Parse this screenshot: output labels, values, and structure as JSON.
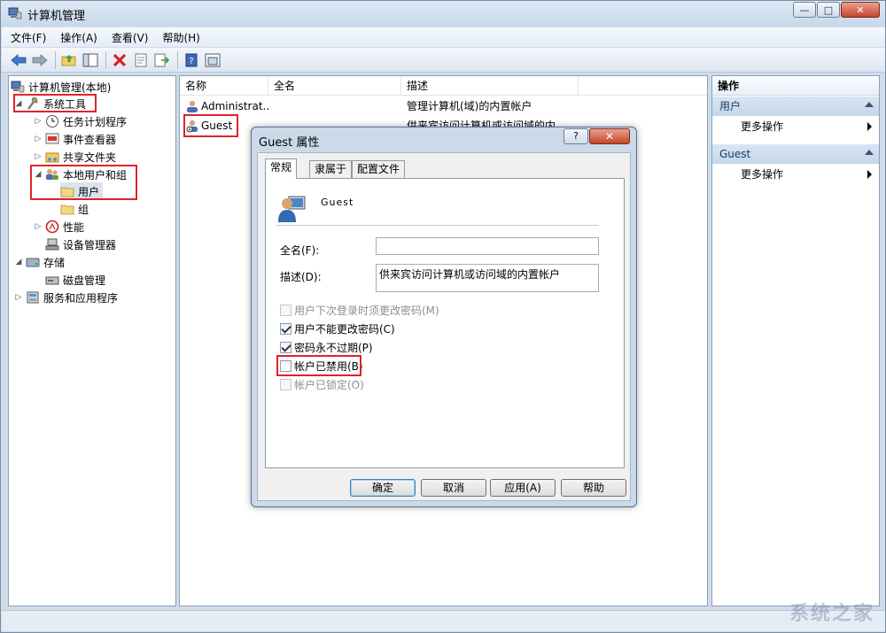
{
  "window": {
    "title": "计算机管理",
    "controls": {
      "minimize": "—",
      "maximize": "□",
      "close": "✕"
    }
  },
  "menu": [
    "文件(F)",
    "操作(A)",
    "查看(V)",
    "帮助(H)"
  ],
  "tree": {
    "root": "计算机管理(本地)",
    "system_tools": "系统工具",
    "task_scheduler": "任务计划程序",
    "event_viewer": "事件查看器",
    "shared_folders": "共享文件夹",
    "local_users_groups": "本地用户和组",
    "users": "用户",
    "groups": "组",
    "performance": "性能",
    "device_manager": "设备管理器",
    "storage": "存储",
    "disk_management": "磁盘管理",
    "services_apps": "服务和应用程序"
  },
  "list": {
    "columns": [
      "名称",
      "全名",
      "描述"
    ],
    "rows": [
      {
        "name": "Administrat...",
        "fullname": "",
        "desc": "管理计算机(域)的内置帐户"
      },
      {
        "name": "Guest",
        "fullname": "",
        "desc": "供来宾访问计算机或访问域的内..."
      }
    ]
  },
  "actions": {
    "title": "操作",
    "sections": [
      {
        "header": "用户",
        "item": "更多操作"
      },
      {
        "header": "Guest",
        "item": "更多操作"
      }
    ]
  },
  "dialog": {
    "title": "Guest 属性",
    "help": "?",
    "close": "✕",
    "tabs": [
      "常规",
      "隶属于",
      "配置文件"
    ],
    "username": "Guest",
    "fullname_label": "全名(F):",
    "fullname_value": "",
    "desc_label": "描述(D):",
    "desc_value": "供来宾访问计算机或访问域的内置帐户",
    "checkboxes": [
      {
        "label": "用户下次登录时须更改密码(M)",
        "checked": false,
        "disabled": true
      },
      {
        "label": "用户不能更改密码(C)",
        "checked": true,
        "disabled": false
      },
      {
        "label": "密码永不过期(P)",
        "checked": true,
        "disabled": false
      },
      {
        "label": "帐户已禁用(B)",
        "checked": false,
        "disabled": false
      },
      {
        "label": "帐户已锁定(O)",
        "checked": false,
        "disabled": true
      }
    ],
    "buttons": {
      "ok": "确定",
      "cancel": "取消",
      "apply": "应用(A)",
      "help": "帮助"
    }
  },
  "watermark": "系统之家",
  "colors": {
    "highlight": "#e0232a",
    "accent": "#1e395b"
  }
}
